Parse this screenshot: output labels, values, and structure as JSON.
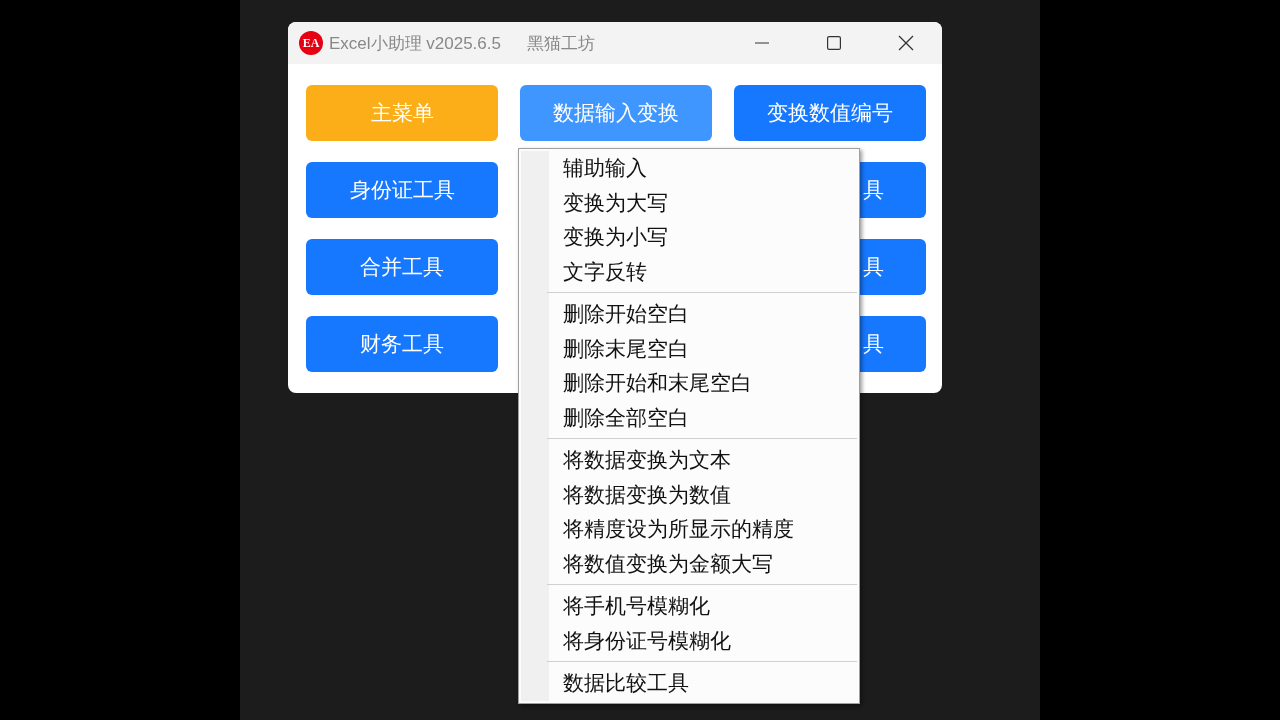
{
  "window": {
    "logo": "EA",
    "title": "Excel小助理 v2025.6.5",
    "subtitle": "黑猫工坊"
  },
  "button_rows": [
    {
      "left": {
        "label": "主菜单",
        "color": "#fbae17"
      },
      "middle": {
        "label": "数据输入变换",
        "color": "#4096ff"
      },
      "right": {
        "label": "变换数值编号",
        "color": "#1677ff",
        "kind": "full"
      }
    },
    {
      "left": {
        "label": "身份证工具",
        "color": "#1677ff"
      },
      "right": {
        "label": "具",
        "color": "#1677ff",
        "kind": "clipped"
      }
    },
    {
      "left": {
        "label": "合并工具",
        "color": "#1677ff"
      },
      "right": {
        "label": "具",
        "color": "#1677ff",
        "kind": "clipped"
      }
    },
    {
      "left": {
        "label": "财务工具",
        "color": "#1677ff"
      },
      "right": {
        "label": "具",
        "color": "#1677ff",
        "kind": "clipped"
      }
    }
  ],
  "menu": {
    "groups": [
      {
        "items": [
          "辅助输入",
          "变换为大写",
          "变换为小写",
          "文字反转"
        ]
      },
      {
        "items": [
          "删除开始空白",
          "删除末尾空白",
          "删除开始和末尾空白",
          "删除全部空白"
        ]
      },
      {
        "items": [
          "将数据变换为文本",
          "将数据变换为数值",
          "将精度设为所显示的精度",
          "将数值变换为金额大写"
        ]
      },
      {
        "items": [
          "将手机号模糊化",
          "将身份证号模糊化"
        ]
      },
      {
        "items": [
          "数据比较工具"
        ]
      }
    ]
  }
}
